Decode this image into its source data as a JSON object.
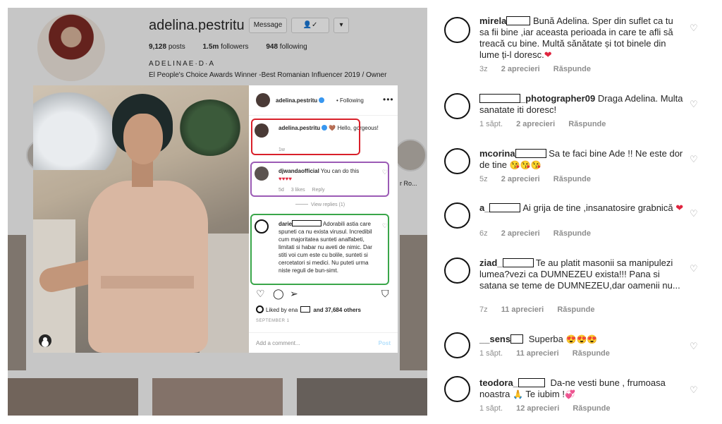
{
  "profile": {
    "username": "adelina.pestritu",
    "message_button": "Message",
    "stats": {
      "posts": "9,128",
      "posts_label": "posts",
      "followers": "1.5m",
      "followers_label": "followers",
      "following": "948",
      "following_label": "following"
    },
    "full_name": "ADELINAE·D·A",
    "bio": "El People's Choice Awards Winner -Best Romanian Influencer 2019 / Owner",
    "highlight_label": "r Ro..."
  },
  "post": {
    "header": {
      "username": "adelina.pestritu",
      "following": "• Following",
      "more": "•••"
    },
    "comments": [
      {
        "user": "adelina.pestritu",
        "text": "Hello, gorgeous!",
        "time": "1w",
        "emoji": "🤎"
      },
      {
        "user": "djwandaofficial",
        "text": "You can do this",
        "hearts": "♥♥♥♥",
        "time": "5d",
        "likes": "3 likes",
        "reply": "Reply",
        "view_replies": "View replies (1)"
      },
      {
        "user": "darie",
        "text": "Adorabili astia care spuneti ca nu exista virusul. Incredibil cum majoritatea sunteti analfabeti, limitati si habar nu aveti de nimic. Dar stiti voi cum este cu bolile, sunteti si cercetatori si medici. Nu puteti urma niste reguli de bun-simt."
      }
    ],
    "liked_by": "Liked by ena",
    "liked_others": "and 37,684 others",
    "date": "SEPTEMBER 1",
    "add_comment": "Add a comment...",
    "post_button": "Post"
  },
  "right_comments": [
    {
      "user": "mirela",
      "text": "Bună Adelina. Sper din suflet ca tu sa fii bine ,iar aceasta perioada in care te afli să treacă cu bine. Multă sănătate și tot binele din lume ți-l doresc.",
      "emoji": "❤",
      "time": "3z",
      "likes": "2 aprecieri",
      "reply": "Răspunde"
    },
    {
      "user": "_photographer09",
      "text": "Draga Adelina. Multa sanatate iti doresc!",
      "time": "1 săpt.",
      "likes": "2 aprecieri",
      "reply": "Răspunde"
    },
    {
      "user": "mcorina",
      "text": "Sa te faci bine Ade !! Ne este dor de tine",
      "emoji": "😘😘😘",
      "time": "5z",
      "likes": "2 aprecieri",
      "reply": "Răspunde"
    },
    {
      "user": "a_",
      "text": "Ai grija de tine ,insanatosire grabnică",
      "emoji": "❤",
      "time": "6z",
      "likes": "2 aprecieri",
      "reply": "Răspunde"
    },
    {
      "user": "ziad_",
      "text": "Te au platit masonii sa manipulezi lumea?vezi ca DUMNEZEU exista!!! Pana si satana se teme de DUMNEZEU,dar oamenii nu...",
      "time": "7z",
      "likes": "11 aprecieri",
      "reply": "Răspunde"
    },
    {
      "user": "__sens",
      "text": "Superba",
      "emoji": "😍😍😍",
      "time": "1 săpt.",
      "likes": "11 aprecieri",
      "reply": "Răspunde"
    },
    {
      "user": "teodora_",
      "text": "Da-ne vesti bune , frumoasa noastra",
      "emoji": "🙏",
      "text2": "Te iubim !",
      "emoji2": "💞",
      "time": "1 săpt.",
      "likes": "12 aprecieri",
      "reply": "Răspunde"
    }
  ],
  "colors": {
    "red_box": "#d9202a",
    "purple_box": "#9b5bb5",
    "green_box": "#3aa64a",
    "verified": "#3897f0"
  }
}
